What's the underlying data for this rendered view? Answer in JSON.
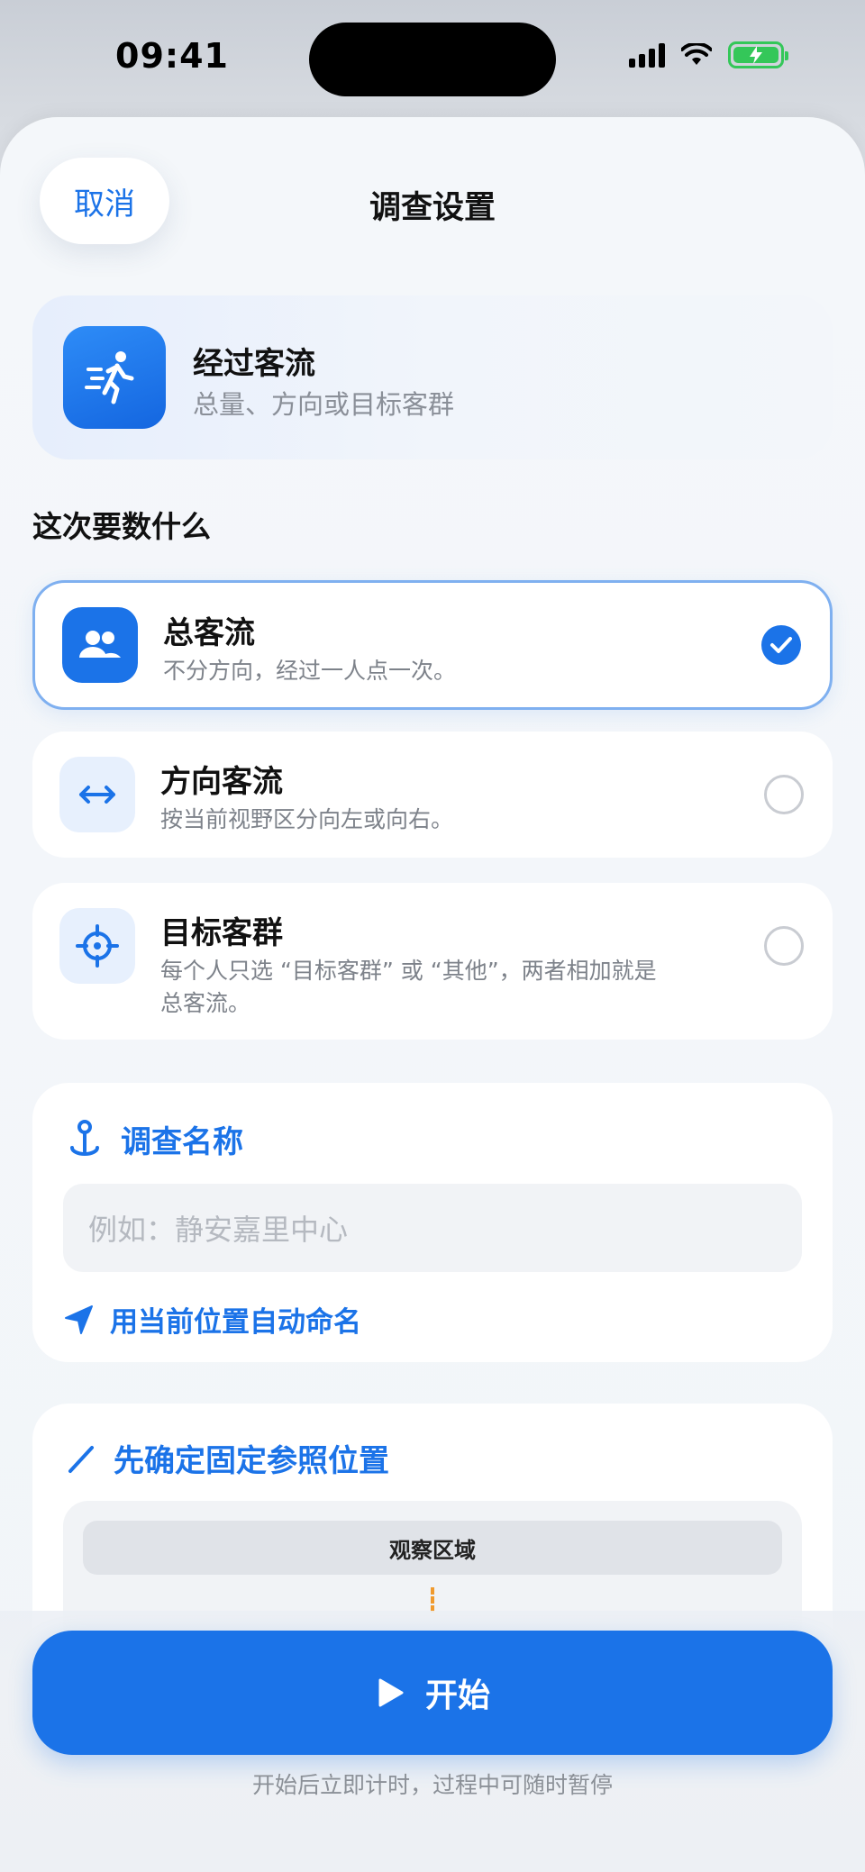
{
  "status_bar": {
    "time": "09:41"
  },
  "header": {
    "cancel_label": "取消",
    "title": "调查设置"
  },
  "survey_type": {
    "title": "经过客流",
    "subtitle": "总量、方向或目标客群",
    "icon": "walking-person-icon"
  },
  "count_section": {
    "label": "这次要数什么",
    "options": [
      {
        "title": "总客流",
        "desc": "不分方向，经过一人点一次。",
        "selected": true,
        "icon": "people-icon"
      },
      {
        "title": "方向客流",
        "desc": "按当前视野区分向左或向右。",
        "selected": false,
        "icon": "left-right-arrow-icon"
      },
      {
        "title": "目标客群",
        "desc": "每个人只选 “目标客群” 或 “其他”，两者相加就是总客流。",
        "selected": false,
        "icon": "crosshair-icon"
      }
    ]
  },
  "name_section": {
    "title": "调查名称",
    "placeholder": "例如：静安嘉里中心",
    "auto_name_label": "用当前位置自动命名"
  },
  "reference_section": {
    "title": "先确定固定参照位置",
    "observation_label": "观察区域"
  },
  "footer": {
    "start_label": "开始",
    "hint": "开始后立即计时，过程中可随时暂停"
  },
  "colors": {
    "accent": "#1b73e8",
    "selected_border": "#7fb0f0",
    "marker": "#f09a2e"
  }
}
